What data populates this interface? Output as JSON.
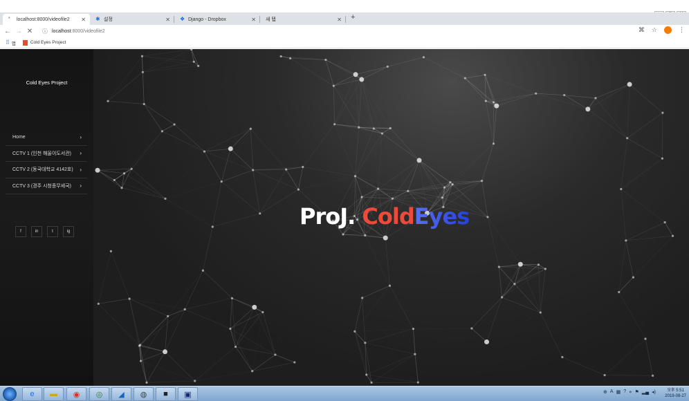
{
  "browser": {
    "tabs": [
      {
        "label": "localhost:8000/videofile2",
        "active": true
      },
      {
        "label": "설정",
        "active": false
      },
      {
        "label": "Django - Dropbox",
        "active": false
      },
      {
        "label": "새 탭",
        "active": false
      }
    ],
    "new_tab_label": "+",
    "url_host": "localhost",
    "url_rest": ":8000/videofile2",
    "bookmarks": {
      "apps_label": "앱",
      "items": [
        "Cold Eyes Project"
      ]
    }
  },
  "page": {
    "brand": "Cold Eyes Project",
    "menu": [
      {
        "label": "Home"
      },
      {
        "label": "CCTV 1 (인천 해울이도서관)"
      },
      {
        "label": "CCTV 2 (동국대학교 4142호)"
      },
      {
        "label": "CCTV 3 (경주 시청종무세국)"
      }
    ],
    "social": [
      "f",
      "in",
      "t",
      "ig"
    ],
    "headline": {
      "part1": "ProJ.",
      "part2": "Cold",
      "part3": "Eyes"
    },
    "colors": {
      "accent_red": "#ec4b3c",
      "accent_blue": "#2540d8"
    }
  },
  "taskbar": {
    "clock_label": "오후 5:51",
    "clock_date": "2019-08-27"
  }
}
